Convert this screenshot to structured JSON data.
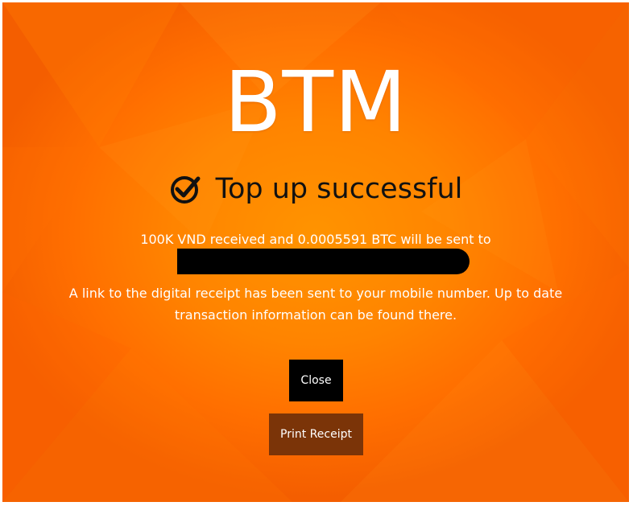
{
  "brand": {
    "logo_text": "BTM"
  },
  "status": {
    "icon": "check-circle-icon",
    "headline": "Top up successful"
  },
  "transaction": {
    "summary": "100K VND received and 0.0005591 BTC will be sent to",
    "address_redacted": true
  },
  "notice": {
    "receipt_message": "A link to the digital receipt has been sent to your mobile number. Up to date transaction information can be found there."
  },
  "actions": {
    "close_label": "Close",
    "print_label": "Print Receipt"
  },
  "colors": {
    "background_accent": "#ff8a00",
    "close_button": "#000000",
    "print_button": "#7b3408",
    "text_primary": "#ffffff",
    "headline_text": "#111111"
  }
}
